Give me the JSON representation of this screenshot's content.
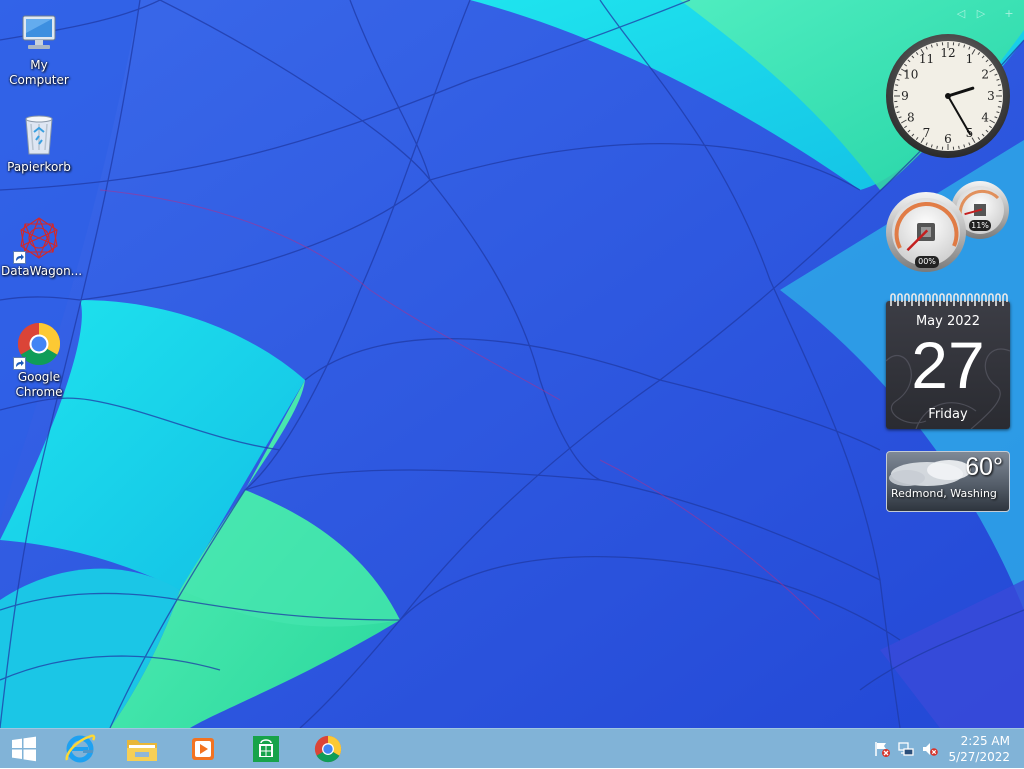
{
  "desktop": {
    "icons": [
      {
        "label": "My Computer",
        "icon": "computer-icon"
      },
      {
        "label": "Papierkorb",
        "icon": "recycle-bin-icon"
      },
      {
        "label": "DataWagon...",
        "icon": "datawagon-icon",
        "shortcut": true
      },
      {
        "label": "Google Chrome",
        "icon": "chrome-icon",
        "shortcut": true
      }
    ]
  },
  "gadgets": {
    "clock": {
      "time": "2:25",
      "numerals": [
        "12",
        "1",
        "2",
        "3",
        "4",
        "5",
        "6",
        "7",
        "8",
        "9",
        "10",
        "11"
      ]
    },
    "cpu_meter": {
      "cpu_label": "00%",
      "cpu_percent": 0,
      "memory_label": "11%",
      "memory_percent": 11
    },
    "calendar": {
      "month": "May 2022",
      "day": "27",
      "weekday": "Friday"
    },
    "weather": {
      "temperature": "60°",
      "location": "Redmond, Washing",
      "condition_icon": "cloudy-icon"
    }
  },
  "taskbar": {
    "pinned": [
      {
        "name": "start",
        "icon": "windows-logo-icon"
      },
      {
        "name": "internet-explorer",
        "icon": "ie-icon"
      },
      {
        "name": "file-explorer",
        "icon": "folder-icon"
      },
      {
        "name": "windows-media-player",
        "icon": "media-player-icon"
      },
      {
        "name": "store",
        "icon": "store-icon"
      },
      {
        "name": "google-chrome",
        "icon": "chrome-icon"
      }
    ],
    "tray": {
      "icons": [
        "action-center-flag-icon",
        "network-icon",
        "volume-muted-icon"
      ],
      "time": "2:25 AM",
      "date": "5/27/2022"
    }
  },
  "colors": {
    "wallpaper_blue": "#2a56e0",
    "wallpaper_cyan": "#18d6ea",
    "wallpaper_green": "#3ee6a8",
    "taskbar": "#4f9ccb"
  }
}
